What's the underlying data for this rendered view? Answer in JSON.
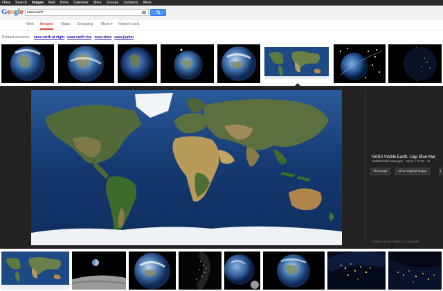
{
  "gbar": [
    "+Tara",
    "Search",
    "Images",
    "Mail",
    "Drive",
    "Calendar",
    "Sites",
    "Groups",
    "Contacts",
    "More"
  ],
  "gbar_active": "Images",
  "logo": "Google",
  "search": {
    "query": "nasa earth"
  },
  "tabs": [
    "Web",
    "Images",
    "Maps",
    "Shopping",
    "More ▾",
    "Search tools"
  ],
  "tab_active": "Images",
  "related": {
    "label": "Related searches:",
    "links": [
      "nasa earth at night",
      "nasa earth rise",
      "nasa stars",
      "nasa jupiter"
    ]
  },
  "preview": {
    "title": "NASA Visible Earth: July, Blue Mar",
    "host": "visibleearth.nasa.gov",
    "dims": " - 5400 × 2700 - M",
    "buttons": [
      "Visit page",
      "View original image",
      "I"
    ],
    "copyright": "Image may be subject to copyright."
  },
  "colors": {
    "accent_red": "#dd4b39",
    "search_blue": "#4d90fe",
    "link_blue": "#1a0dab",
    "panel_dark": "#222222"
  }
}
